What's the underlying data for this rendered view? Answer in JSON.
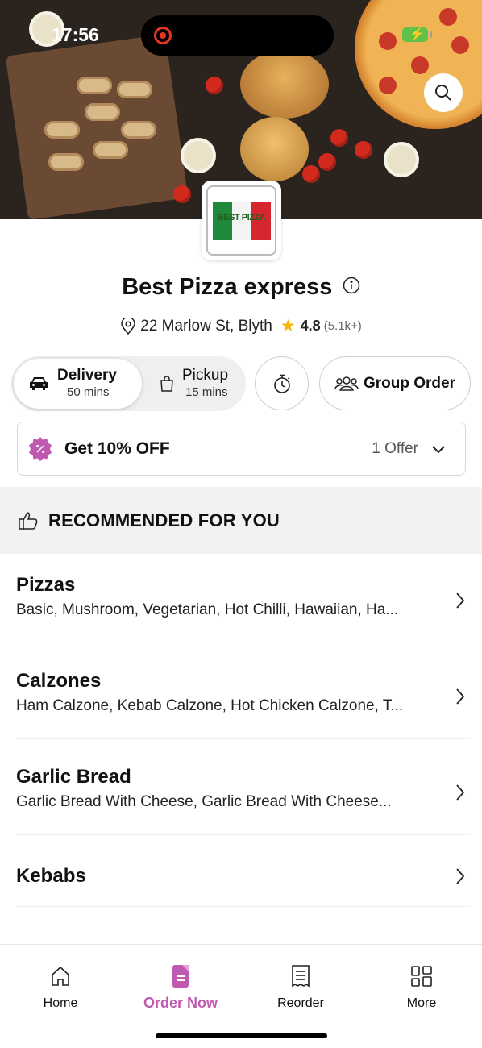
{
  "status_bar": {
    "time": "17:56"
  },
  "hero": {
    "icon": "search-icon"
  },
  "restaurant": {
    "logo_text": "BEST PIZZA",
    "name": "Best Pizza express",
    "address": "22 Marlow St, Blyth",
    "rating": "4.8",
    "rating_count": "(5.1k+)"
  },
  "fulfillment": {
    "delivery_label": "Delivery",
    "delivery_time": "50 mins",
    "pickup_label": "Pickup",
    "pickup_time": "15 mins",
    "selected": "Delivery",
    "group_order_label": "Group Order"
  },
  "offer": {
    "title": "Get 10% OFF",
    "count": "1 Offer"
  },
  "recommended": {
    "label": "RECOMMENDED FOR YOU"
  },
  "categories": [
    {
      "name": "Pizzas",
      "items": "Basic, Mushroom, Vegetarian, Hot Chilli, Hawaiian, Ha..."
    },
    {
      "name": "Calzones",
      "items": "Ham Calzone, Kebab Calzone, Hot Chicken Calzone, T..."
    },
    {
      "name": "Garlic Bread",
      "items": "Garlic Bread With Cheese, Garlic Bread With Cheese..."
    },
    {
      "name": "Kebabs",
      "items": ""
    }
  ],
  "bottom_nav": {
    "items": [
      {
        "label": "Home",
        "icon": "home-icon"
      },
      {
        "label": "Order Now",
        "icon": "order-icon"
      },
      {
        "label": "Reorder",
        "icon": "receipt-icon"
      },
      {
        "label": "More",
        "icon": "grid-icon"
      }
    ],
    "active": "Order Now"
  },
  "colors": {
    "accent": "#c05ab0",
    "star": "#f4b400",
    "battery": "#5ec248",
    "recording": "#e53424"
  }
}
